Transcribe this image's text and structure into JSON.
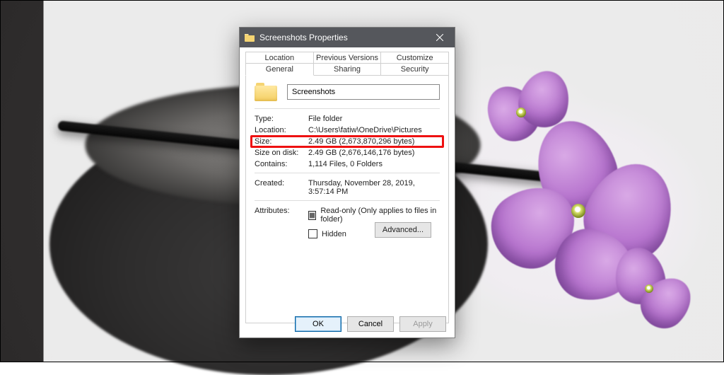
{
  "window": {
    "title": "Screenshots Properties"
  },
  "tabs": {
    "row1": [
      "Location",
      "Previous Versions",
      "Customize"
    ],
    "row2": [
      "General",
      "Sharing",
      "Security"
    ],
    "active": "General"
  },
  "general": {
    "name": "Screenshots",
    "type_label": "Type:",
    "type_value": "File folder",
    "location_label": "Location:",
    "location_value": "C:\\Users\\fatiw\\OneDrive\\Pictures",
    "size_label": "Size:",
    "size_value": "2.49 GB (2,673,870,296 bytes)",
    "sizeondisk_label": "Size on disk:",
    "sizeondisk_value": "2.49 GB (2,676,146,176 bytes)",
    "contains_label": "Contains:",
    "contains_value": "1,114 Files, 0 Folders",
    "created_label": "Created:",
    "created_value": "Thursday, November 28, 2019, 3:57:14 PM",
    "attributes_label": "Attributes:",
    "readonly_label": "Read-only (Only applies to files in folder)",
    "hidden_label": "Hidden",
    "advanced_btn": "Advanced..."
  },
  "buttons": {
    "ok": "OK",
    "cancel": "Cancel",
    "apply": "Apply"
  }
}
